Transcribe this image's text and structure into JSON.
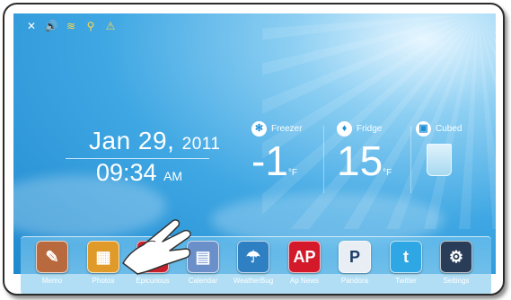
{
  "statusbar": {
    "icons": [
      "close-icon",
      "volume-icon",
      "wifi-icon",
      "person-icon",
      "alarm-icon"
    ],
    "glyphs": [
      "✕",
      "🔊",
      "≋",
      "⚲",
      "⚠"
    ]
  },
  "clock": {
    "date": "Jan 29,",
    "year": "2011",
    "time": "09:34",
    "ampm": "AM"
  },
  "zones": {
    "freezer": {
      "label": "Freezer",
      "value": "-1",
      "unit": "°F"
    },
    "fridge": {
      "label": "Fridge",
      "value": "15",
      "unit": "°F"
    },
    "cubed": {
      "label": "Cubed"
    }
  },
  "dock": {
    "apps": [
      {
        "label": "Memo",
        "glyph": "✎",
        "color": "#b86a3e"
      },
      {
        "label": "Photos",
        "glyph": "▦",
        "color": "#e09a2a"
      },
      {
        "label": "Epicurious",
        "glyph": "epi",
        "color": "#c71f2c"
      },
      {
        "label": "Calendar",
        "glyph": "▤",
        "color": "#6a8fc9"
      },
      {
        "label": "WeatherBug",
        "glyph": "☂",
        "color": "#2f7fc3"
      },
      {
        "label": "Ap News",
        "glyph": "AP",
        "color": "#d3192a"
      },
      {
        "label": "Pandora",
        "glyph": "P",
        "color": "#e9eef4"
      },
      {
        "label": "Twitter",
        "glyph": "t",
        "color": "#2fa7e4"
      },
      {
        "label": "Settings",
        "glyph": "⚙",
        "color": "#2a3d58"
      }
    ]
  }
}
